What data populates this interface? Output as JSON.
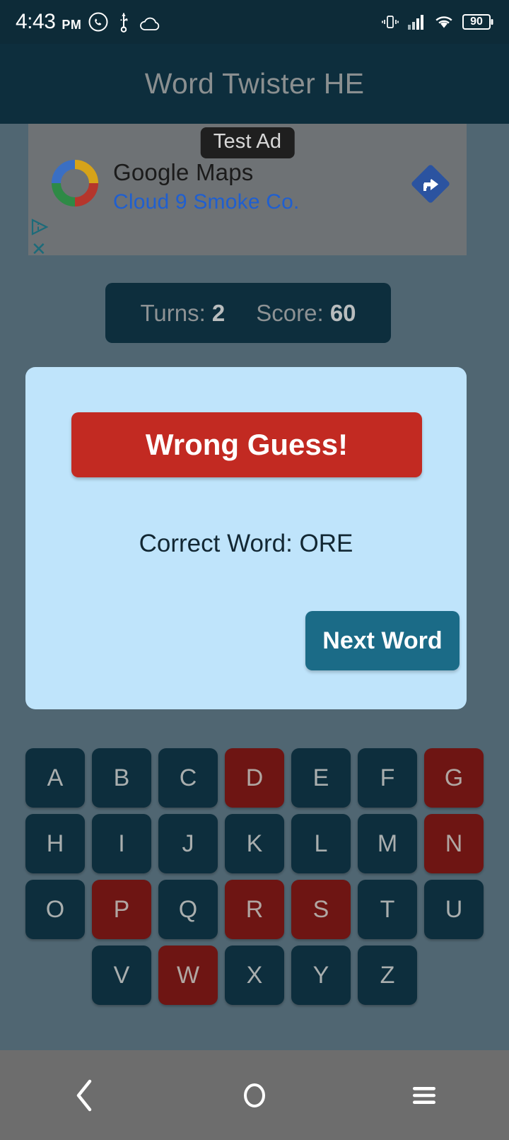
{
  "status_bar": {
    "time": "4:43",
    "ampm": "PM",
    "icons_left": [
      "whatsapp-icon",
      "usb-icon",
      "cloud-icon"
    ],
    "icons_right": [
      "vibrate-icon",
      "signal-icon",
      "wifi-icon",
      "battery-icon"
    ],
    "battery_level": "90"
  },
  "app_bar": {
    "title": "Word Twister HE"
  },
  "ad": {
    "badge": "Test Ad",
    "title": "Google Maps",
    "subtitle": "Cloud 9 Smoke Co.",
    "logo_icon": "google-maps-ring-icon",
    "cta_icon": "navigation-arrow-icon",
    "adchoices_icon": "adchoices-icon",
    "close_label": "✕"
  },
  "score_bar": {
    "turns_label": "Turns:",
    "turns_value": "2",
    "score_label": "Score:",
    "score_value": "60"
  },
  "dialog": {
    "result_banner": "Wrong Guess!",
    "correct_word_text": "Correct Word: ORE",
    "next_button": "Next Word"
  },
  "keyboard": {
    "rows": [
      [
        {
          "letter": "A",
          "used": false
        },
        {
          "letter": "B",
          "used": false
        },
        {
          "letter": "C",
          "used": false
        },
        {
          "letter": "D",
          "used": true
        },
        {
          "letter": "E",
          "used": false
        },
        {
          "letter": "F",
          "used": false
        },
        {
          "letter": "G",
          "used": true
        }
      ],
      [
        {
          "letter": "H",
          "used": false
        },
        {
          "letter": "I",
          "used": false
        },
        {
          "letter": "J",
          "used": false
        },
        {
          "letter": "K",
          "used": false
        },
        {
          "letter": "L",
          "used": false
        },
        {
          "letter": "M",
          "used": false
        },
        {
          "letter": "N",
          "used": true
        }
      ],
      [
        {
          "letter": "O",
          "used": false
        },
        {
          "letter": "P",
          "used": true
        },
        {
          "letter": "Q",
          "used": false
        },
        {
          "letter": "R",
          "used": true
        },
        {
          "letter": "S",
          "used": true
        },
        {
          "letter": "T",
          "used": false
        },
        {
          "letter": "U",
          "used": false
        }
      ],
      [
        {
          "letter": "V",
          "used": false
        },
        {
          "letter": "W",
          "used": true
        },
        {
          "letter": "X",
          "used": false
        },
        {
          "letter": "Y",
          "used": false
        },
        {
          "letter": "Z",
          "used": false
        }
      ]
    ]
  },
  "nav_bar": {
    "back_icon": "back-chevron-icon",
    "home_icon": "home-circle-icon",
    "recents_icon": "recents-menu-icon"
  },
  "colors": {
    "background": "#506672",
    "app_bar": "#0d2e3d",
    "status_bar": "#0d2b38",
    "dialog": "#bfe4fb",
    "wrong_red": "#c22a22",
    "key_default": "#0d2e3d",
    "key_used": "#6e1513",
    "accent_teal": "#1b6b87",
    "ad_link_blue": "#1f5fd0"
  }
}
